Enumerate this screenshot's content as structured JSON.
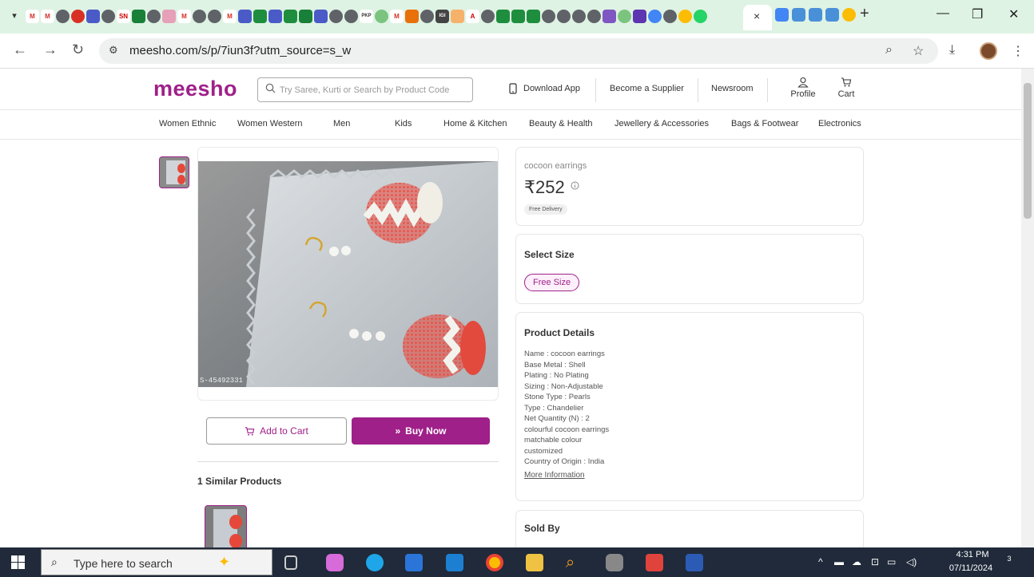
{
  "browser": {
    "url": "meesho.com/s/p/7iun3f?utm_source=s_w",
    "close_tab_glyph": "×",
    "new_tab_glyph": "+"
  },
  "header": {
    "logo": "meesho",
    "search_placeholder": "Try Saree, Kurti or Search by Product Code",
    "download_app": "Download App",
    "become_supplier": "Become a Supplier",
    "newsroom": "Newsroom",
    "profile": "Profile",
    "cart": "Cart"
  },
  "categories": [
    "Women Ethnic",
    "Women Western",
    "Men",
    "Kids",
    "Home & Kitchen",
    "Beauty & Health",
    "Jewellery & Accessories",
    "Bags & Footwear",
    "Electronics"
  ],
  "product": {
    "name": "cocoon earrings",
    "price": "₹252",
    "delivery": "Free Delivery",
    "image_caption": "S-45492331"
  },
  "actions": {
    "add_to_cart": "Add to Cart",
    "buy_now": "Buy Now"
  },
  "similar": {
    "title": "1 Similar Products"
  },
  "size": {
    "title": "Select Size",
    "option": "Free Size"
  },
  "details": {
    "title": "Product Details",
    "lines": [
      "Name : cocoon earrings",
      "Base Metal : Shell",
      "Plating : No Plating",
      "Sizing : Non-Adjustable",
      "Stone Type : Pearls",
      "Type : Chandelier",
      "Net Quantity (N) : 2",
      "colourful cocoon earrings",
      "matchable colour",
      "customized",
      "Country of Origin : India"
    ],
    "more": "More Information"
  },
  "sold_by": {
    "title": "Sold By"
  },
  "taskbar": {
    "search_placeholder": "Type here to search",
    "time": "4:31 PM",
    "date": "07/11/2024",
    "notifications": "3"
  },
  "colors": {
    "brand": "#9f2089",
    "tabstrip": "#dff3e4",
    "taskbar": "#202a3a"
  }
}
